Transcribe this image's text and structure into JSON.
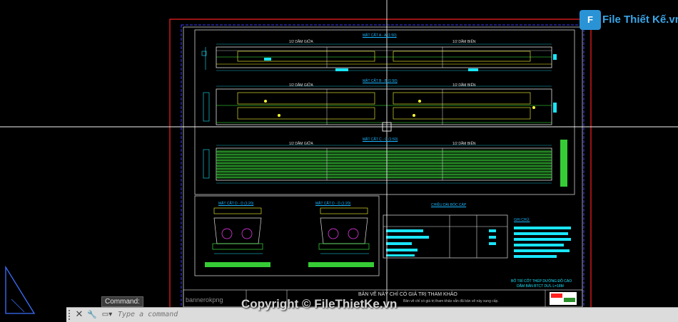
{
  "watermark": {
    "logo_letter": "F",
    "logo_text": "File Thiết Kế.vn",
    "copyright": "Copyright © FileThietKe.vn"
  },
  "drawing": {
    "sections": [
      {
        "title": "MẶT CẮT A - A (1:50)",
        "left_label": "1/2 DẦM GIỮA",
        "right_label": "1/2 DẦM BIÊN"
      },
      {
        "title": "MẶT CẮT B - B (1:50)",
        "left_label": "1/2 DẦM GIỮA",
        "right_label": "1/2 DẦM BIÊN"
      },
      {
        "title": "MẶT CẮT C - C (1:50)",
        "left_label": "1/2 DẦM GIỮA",
        "right_label": "1/2 DẦM BIÊN"
      }
    ],
    "detail_titles": [
      "MẶT CẮT D - D (1:20)",
      "MẶT CẮT D - D (1:20)"
    ],
    "table_title": "CHIỀU DÀI BÓC CÁP",
    "notes_title": "GHI CHÚ:",
    "footer_note": "BẢN VẼ NÀY CHỈ CÓ GIÁ TRỊ THAM KHẢO",
    "footer_sub": "Bản vẽ chỉ có giá trị tham khảo vẫn đã bản vẽ này sung cấp.",
    "stamp_lines": [
      "BỐ TRÍ CỐT THÉP DƯỜNG ĐỒ CÁO",
      "DẦM BẢN BTCT DƯL L=18M"
    ],
    "banner_text": "bannerokpng"
  },
  "command": {
    "tag": "Command:",
    "placeholder": "Type a command",
    "close_glyph": "✕",
    "wrench_glyph": "🔧",
    "prompt_glyph": "▭▾"
  },
  "colors": {
    "background": "#000000",
    "frame_red": "#ff2020",
    "frame_blue": "#3a3aff",
    "cyan": "#19e6ff",
    "green": "#43ff43",
    "yellow": "#ffff33",
    "white": "#e6e6e6"
  }
}
